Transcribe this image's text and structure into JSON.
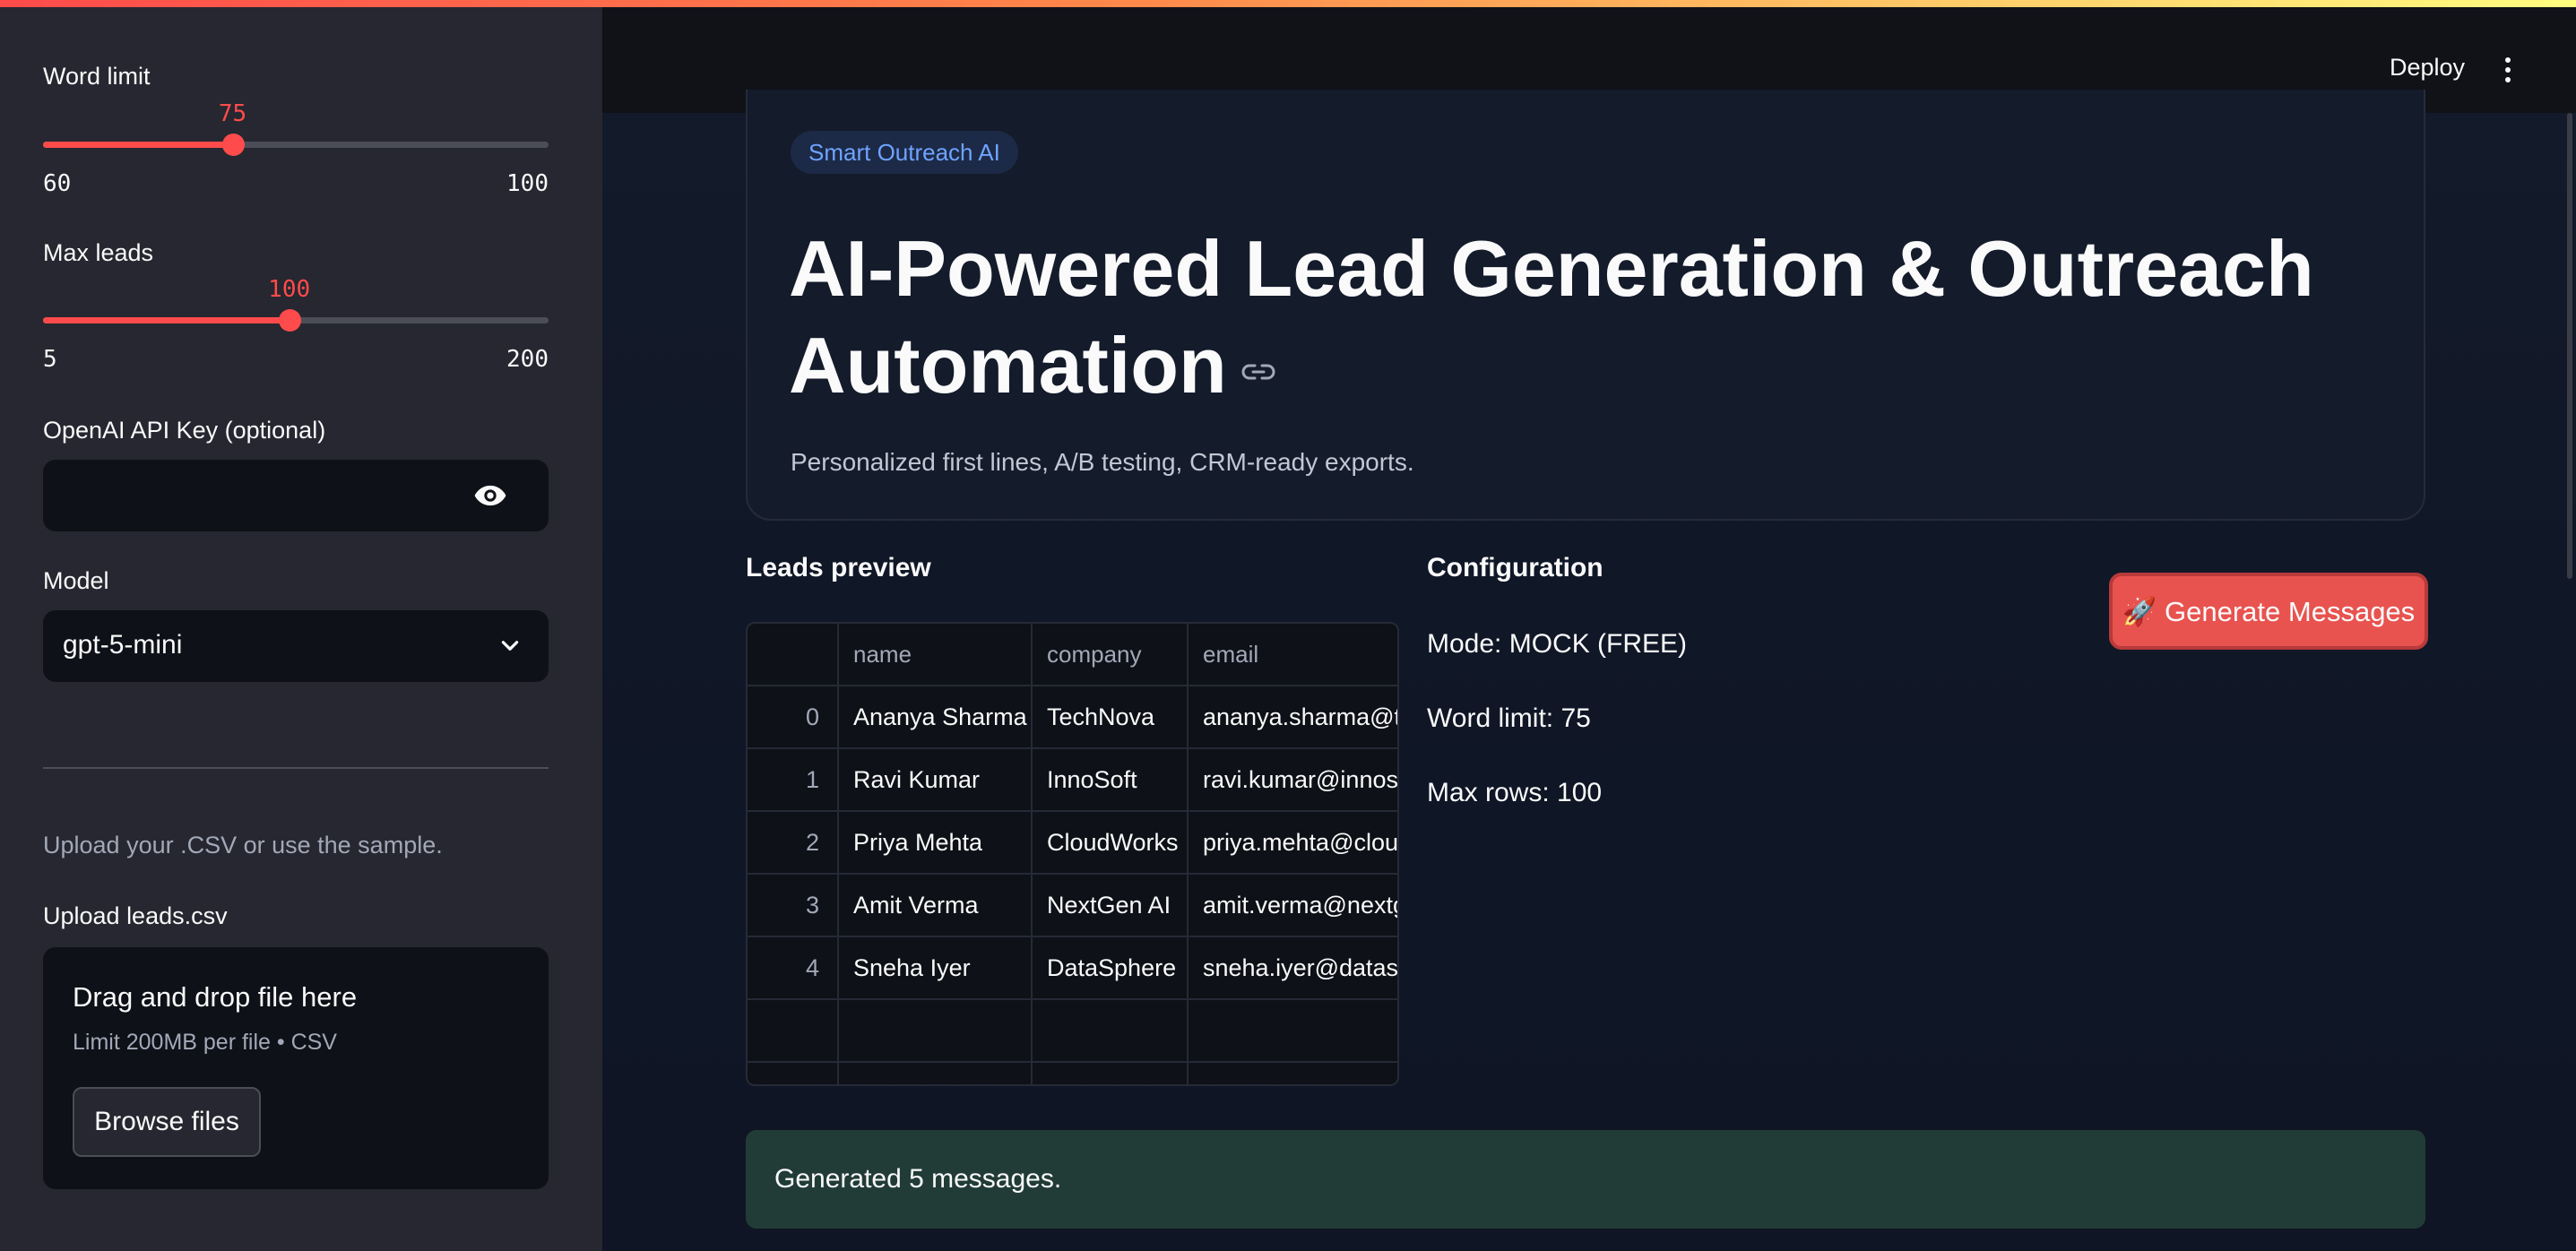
{
  "sidebar": {
    "word_limit": {
      "label": "Word limit",
      "value": "75",
      "min": "60",
      "max": "100",
      "fraction": 0.375
    },
    "max_leads": {
      "label": "Max leads",
      "value": "100",
      "min": "5",
      "max": "200",
      "fraction": 0.487
    },
    "api_key": {
      "label": "OpenAI API Key (optional)",
      "value": ""
    },
    "model": {
      "label": "Model",
      "value": "gpt-5-mini"
    },
    "hint": "Upload your .CSV or use the sample.",
    "upload": {
      "label": "Upload leads.csv",
      "title": "Drag and drop file here",
      "sub": "Limit 200MB per file • CSV",
      "browse": "Browse files"
    }
  },
  "header": {
    "deploy": "Deploy"
  },
  "hero": {
    "pill": "Smart Outreach AI",
    "title": "AI-Powered Lead Generation & Outreach Automation",
    "subtitle": "Personalized first lines, A/B testing, CRM-ready exports."
  },
  "leads": {
    "title": "Leads preview",
    "columns": [
      "",
      "name",
      "company",
      "email"
    ],
    "rows": [
      [
        "0",
        "Ananya Sharma",
        "TechNova",
        "ananya.sharma@te"
      ],
      [
        "1",
        "Ravi Kumar",
        "InnoSoft",
        "ravi.kumar@innosc"
      ],
      [
        "2",
        "Priya Mehta",
        "CloudWorks",
        "priya.mehta@clouc"
      ],
      [
        "3",
        "Amit Verma",
        "NextGen AI",
        "amit.verma@nextg"
      ],
      [
        "4",
        "Sneha Iyer",
        "DataSphere",
        "sneha.iyer@datasp"
      ]
    ]
  },
  "config": {
    "title": "Configuration",
    "mode": "Mode: MOCK (FREE)",
    "word_limit": "Word limit: 75",
    "max_rows": "Max rows: 100",
    "generate": "🚀 Generate Messages"
  },
  "status": {
    "message": "Generated 5 messages."
  },
  "colors": {
    "accent": "#ff4b4b",
    "success_bg": "#213c36",
    "pill_text": "#6fa3ff"
  }
}
